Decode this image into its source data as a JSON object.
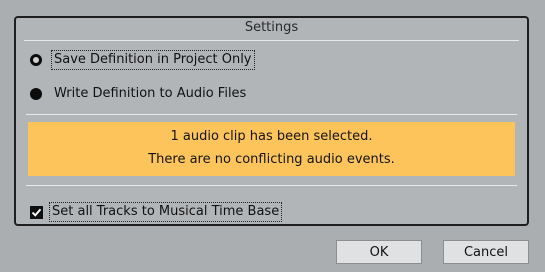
{
  "settings": {
    "title": "Settings",
    "options": [
      {
        "label": "Save Definition in Project Only",
        "selected": false
      },
      {
        "label": "Write Definition to Audio Files",
        "selected": true
      }
    ],
    "info": {
      "line1": "1 audio clip has been selected.",
      "line2": "There are no conflicting audio events.",
      "background": "#fcc45a"
    },
    "checkbox": {
      "label": "Set all Tracks to Musical Time Base",
      "checked": true
    }
  },
  "buttons": {
    "ok": "OK",
    "cancel": "Cancel"
  }
}
